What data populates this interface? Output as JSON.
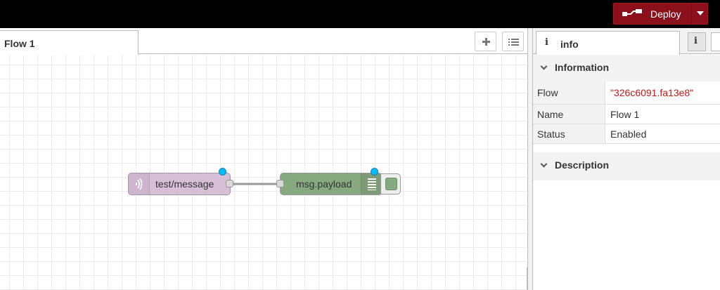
{
  "header": {
    "deploy_label": "Deploy",
    "accent_color": "#8c101c"
  },
  "workspace": {
    "tabs": [
      {
        "label": "Flow 1",
        "active": true
      }
    ],
    "add_tab_icon": "plus-icon",
    "tab_list_icon": "list-icon"
  },
  "flow": {
    "nodes": [
      {
        "type": "mqtt in",
        "label": "test/message",
        "color": "#d8bfd8",
        "icon": "mqtt-icon",
        "changed": true
      },
      {
        "type": "debug",
        "label": "msg.payload",
        "color": "#87a980",
        "icon": "debug-list-icon",
        "changed": true,
        "active": true
      }
    ],
    "wires": [
      {
        "from": "test/message",
        "to": "msg.payload"
      }
    ]
  },
  "sidebar": {
    "active_tab": {
      "icon_glyph": "i",
      "label": "info"
    },
    "info_button_glyph": "i",
    "sections": {
      "information": {
        "title": "Information",
        "rows": [
          {
            "key": "Flow",
            "value": "\"326c6091.fa13e8\""
          },
          {
            "key": "Name",
            "value": "Flow 1"
          },
          {
            "key": "Status",
            "value": "Enabled"
          }
        ]
      },
      "description": {
        "title": "Description"
      }
    }
  }
}
